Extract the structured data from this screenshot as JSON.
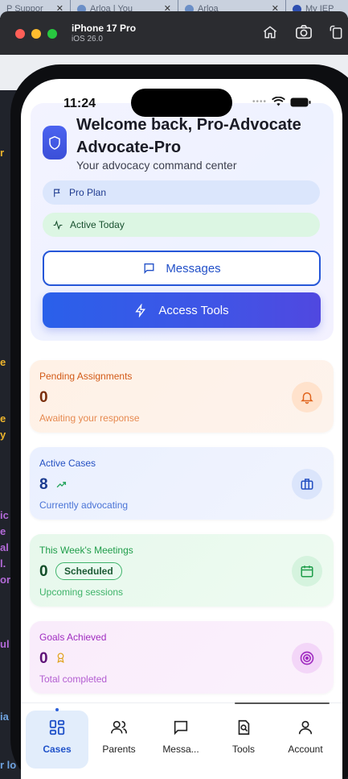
{
  "browser": {
    "tabs": [
      {
        "label": "P Suppor"
      },
      {
        "label": "Arloa | You"
      },
      {
        "label": "Arloa"
      },
      {
        "label": "My IEP"
      }
    ]
  },
  "simulator": {
    "device": "iPhone 17 Pro",
    "os": "iOS 26.0",
    "buttons": [
      "home-icon",
      "screenshot-icon",
      "rotate-icon"
    ]
  },
  "status_bar": {
    "time": "11:24"
  },
  "header": {
    "welcome": "Welcome back, Pro-Advocate Advocate-Pro",
    "tagline": "Your advocacy command center",
    "plan_pill": "Pro Plan",
    "activity_pill": "Active Today",
    "messages_button": "Messages",
    "tools_button": "Access Tools"
  },
  "stats": [
    {
      "title": "Pending Assignments",
      "value": "0",
      "subtitle": "Awaiting your response",
      "icon": "bell-icon",
      "color": "#e0621a"
    },
    {
      "title": "Active Cases",
      "value": "8",
      "subtitle": "Currently advocating",
      "icon": "briefcase-icon",
      "color": "#2450c2"
    },
    {
      "title": "This Week's Meetings",
      "value": "0",
      "badge": "Scheduled",
      "subtitle": "Upcoming sessions",
      "icon": "calendar-icon",
      "color": "#1f9d4a"
    },
    {
      "title": "Goals Achieved",
      "value": "0",
      "subtitle": "Total completed",
      "icon": "target-icon",
      "color": "#a02cc0"
    }
  ],
  "tabbar": {
    "items": [
      {
        "label": "Cases",
        "icon": "grid-icon",
        "active": true
      },
      {
        "label": "Parents",
        "icon": "users-icon"
      },
      {
        "label": "Messa...",
        "icon": "message-icon"
      },
      {
        "label": "Tools",
        "icon": "tools-icon"
      },
      {
        "label": "Account",
        "icon": "user-icon"
      }
    ]
  },
  "colors": {
    "accent": "#2a5fe0",
    "active_tab_bg": "#e2edfb"
  }
}
